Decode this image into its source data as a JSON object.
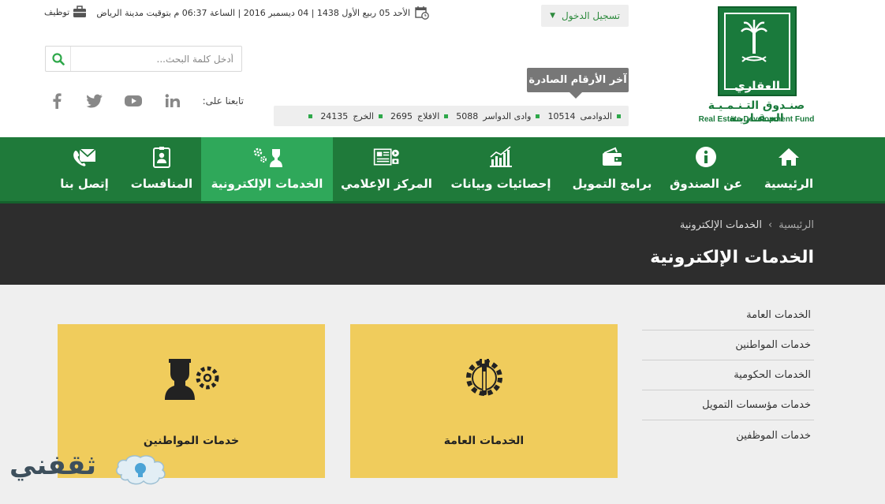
{
  "header": {
    "logo": {
      "emblem_text": "العقاري",
      "name_ar": "صنـدوق التـنـمـيـة العـقـاريـة",
      "name_en": "Real Estate Development Fund"
    },
    "login_label": "تسجيل الدخول",
    "date_text": "الأحد 05 ربيع الأول 1438 | 04 ديسمبر 2016 | الساعة 06:37 م بتوقيت مدينة الرياض",
    "jobs_label": "توظيف",
    "search_placeholder": "أدخل كلمة البحث...",
    "follow_label": "تابعنا على:",
    "social_icons": [
      "linkedin-icon",
      "youtube-icon",
      "twitter-icon",
      "facebook-icon"
    ],
    "latest_label": "آخر الأرقام الصادرة",
    "ticker": [
      {
        "city": "الدوادمى",
        "number": "10514"
      },
      {
        "city": "وادى الدواسر",
        "number": "5088"
      },
      {
        "city": "الافلاج",
        "number": "2695"
      },
      {
        "city": "الخرج",
        "number": "24135"
      }
    ]
  },
  "nav": {
    "items": [
      {
        "label": "الرئيسية",
        "icon": "home-icon"
      },
      {
        "label": "عن الصندوق",
        "icon": "info-icon"
      },
      {
        "label": "برامج التمويل",
        "icon": "wallet-icon"
      },
      {
        "label": "إحصائيات وبيانات",
        "icon": "chart-icon"
      },
      {
        "label": "المركز الإعلامي",
        "icon": "media-icon"
      },
      {
        "label": "الخدمات الإلكترونية",
        "icon": "e-services-icon",
        "active": true
      },
      {
        "label": "المنافسات",
        "icon": "badge-icon"
      },
      {
        "label": "إتصل بنا",
        "icon": "contact-icon"
      }
    ]
  },
  "page": {
    "breadcrumb_home": "الرئيسية",
    "breadcrumb_sep": "›",
    "breadcrumb_current": "الخدمات الإلكترونية",
    "title": "الخدمات الإلكترونية"
  },
  "sidebar": {
    "items": [
      {
        "label": "الخدمات العامة"
      },
      {
        "label": "خدمات المواطنين"
      },
      {
        "label": "الخدمات الحكومية"
      },
      {
        "label": "خدمات مؤسسات التمويل"
      },
      {
        "label": "خدمات الموظفين"
      }
    ]
  },
  "cards": [
    {
      "label": "الخدمات العامة",
      "icon": "gears-tools-icon"
    },
    {
      "label": "خدمات المواطنين",
      "icon": "citizen-gear-icon"
    }
  ],
  "watermark": {
    "text": "ثقفني"
  },
  "colors": {
    "primary_green": "#1f7a3a",
    "active_green": "#2fa85a",
    "card_yellow": "#f0cc5c",
    "dark_band": "#2d2d2d"
  }
}
